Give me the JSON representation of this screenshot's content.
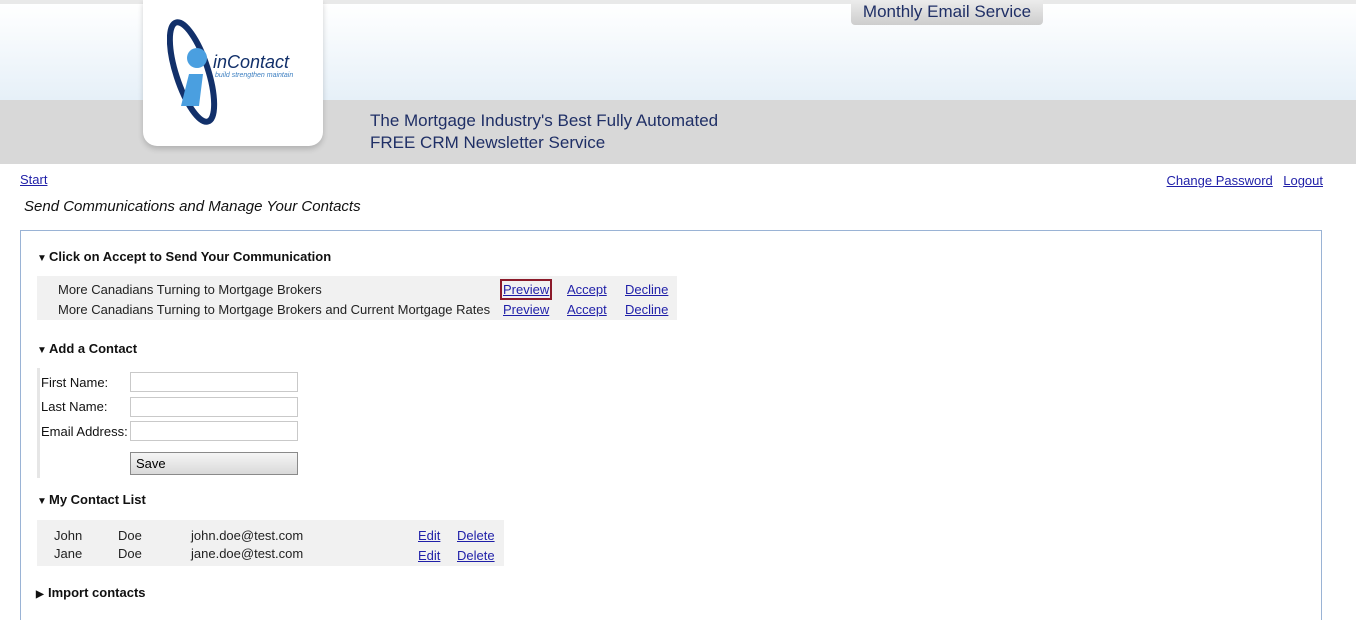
{
  "header": {
    "service_tab": "Monthly Email Service",
    "logo_name": "inContact",
    "logo_tagline": "build strengthen maintain",
    "tagline_line1": "The Mortgage Industry's Best Fully Automated",
    "tagline_line2": "FREE CRM Newsletter Service"
  },
  "nav": {
    "start": "Start",
    "change_password": "Change Password",
    "logout": "Logout"
  },
  "page_title": "Send Communications and Manage Your Contacts",
  "communications": {
    "title": "Click on Accept to Send Your Communication",
    "items": [
      {
        "title": "More Canadians Turning to Mortgage Brokers",
        "preview": "Preview",
        "accept": "Accept",
        "decline": "Decline"
      },
      {
        "title": "More Canadians Turning to Mortgage Brokers and Current Mortgage Rates",
        "preview": "Preview",
        "accept": "Accept",
        "decline": "Decline"
      }
    ]
  },
  "add_contact": {
    "title": "Add a Contact",
    "first_name_label": "First Name:",
    "last_name_label": "Last Name:",
    "email_label": "Email Address:",
    "first_name_value": "",
    "last_name_value": "",
    "email_value": "",
    "save_label": "Save"
  },
  "contact_list": {
    "title": "My Contact List",
    "contacts": [
      {
        "first": "John",
        "last": "Doe",
        "email": "john.doe@test.com",
        "edit": "Edit",
        "delete": "Delete"
      },
      {
        "first": "Jane",
        "last": "Doe",
        "email": "jane.doe@test.com",
        "edit": "Edit",
        "delete": "Delete"
      }
    ]
  },
  "import": {
    "title": "Import contacts"
  },
  "icons": {
    "expanded": "▼",
    "collapsed": "▶"
  },
  "colors": {
    "link": "#1f1fa8",
    "brand_navy": "#1f2f66",
    "highlight": "#8b1a2a",
    "panel_border": "#9ab3d5"
  }
}
